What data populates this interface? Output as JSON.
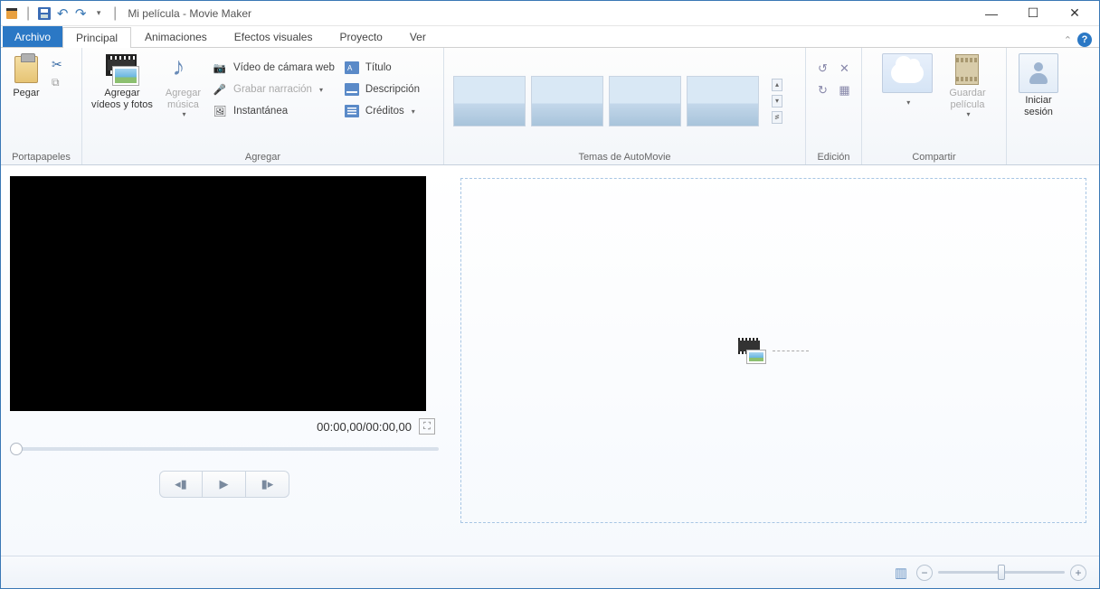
{
  "titlebar": {
    "app_title": "Mi película - Movie Maker"
  },
  "tabs": {
    "archivo": "Archivo",
    "items": [
      "Principal",
      "Animaciones",
      "Efectos visuales",
      "Proyecto",
      "Ver"
    ],
    "active_index": 0
  },
  "ribbon": {
    "portapapeles": {
      "group": "Portapapeles",
      "pegar": "Pegar"
    },
    "agregar": {
      "group": "Agregar",
      "videos_fotos": "Agregar\nvídeos y fotos",
      "musica": "Agregar\nmúsica",
      "video_camara": "Vídeo de cámara web",
      "grabar_narracion": "Grabar narración",
      "instantanea": "Instantánea",
      "titulo": "Título",
      "descripcion": "Descripción",
      "creditos": "Créditos"
    },
    "automovie": {
      "group": "Temas de AutoMovie"
    },
    "edicion": {
      "group": "Edición"
    },
    "compartir": {
      "group": "Compartir",
      "guardar_pelicula": "Guardar\npelícula"
    },
    "sesion": {
      "iniciar": "Iniciar\nsesión"
    }
  },
  "preview": {
    "timecode": "00:00,00/00:00,00"
  }
}
